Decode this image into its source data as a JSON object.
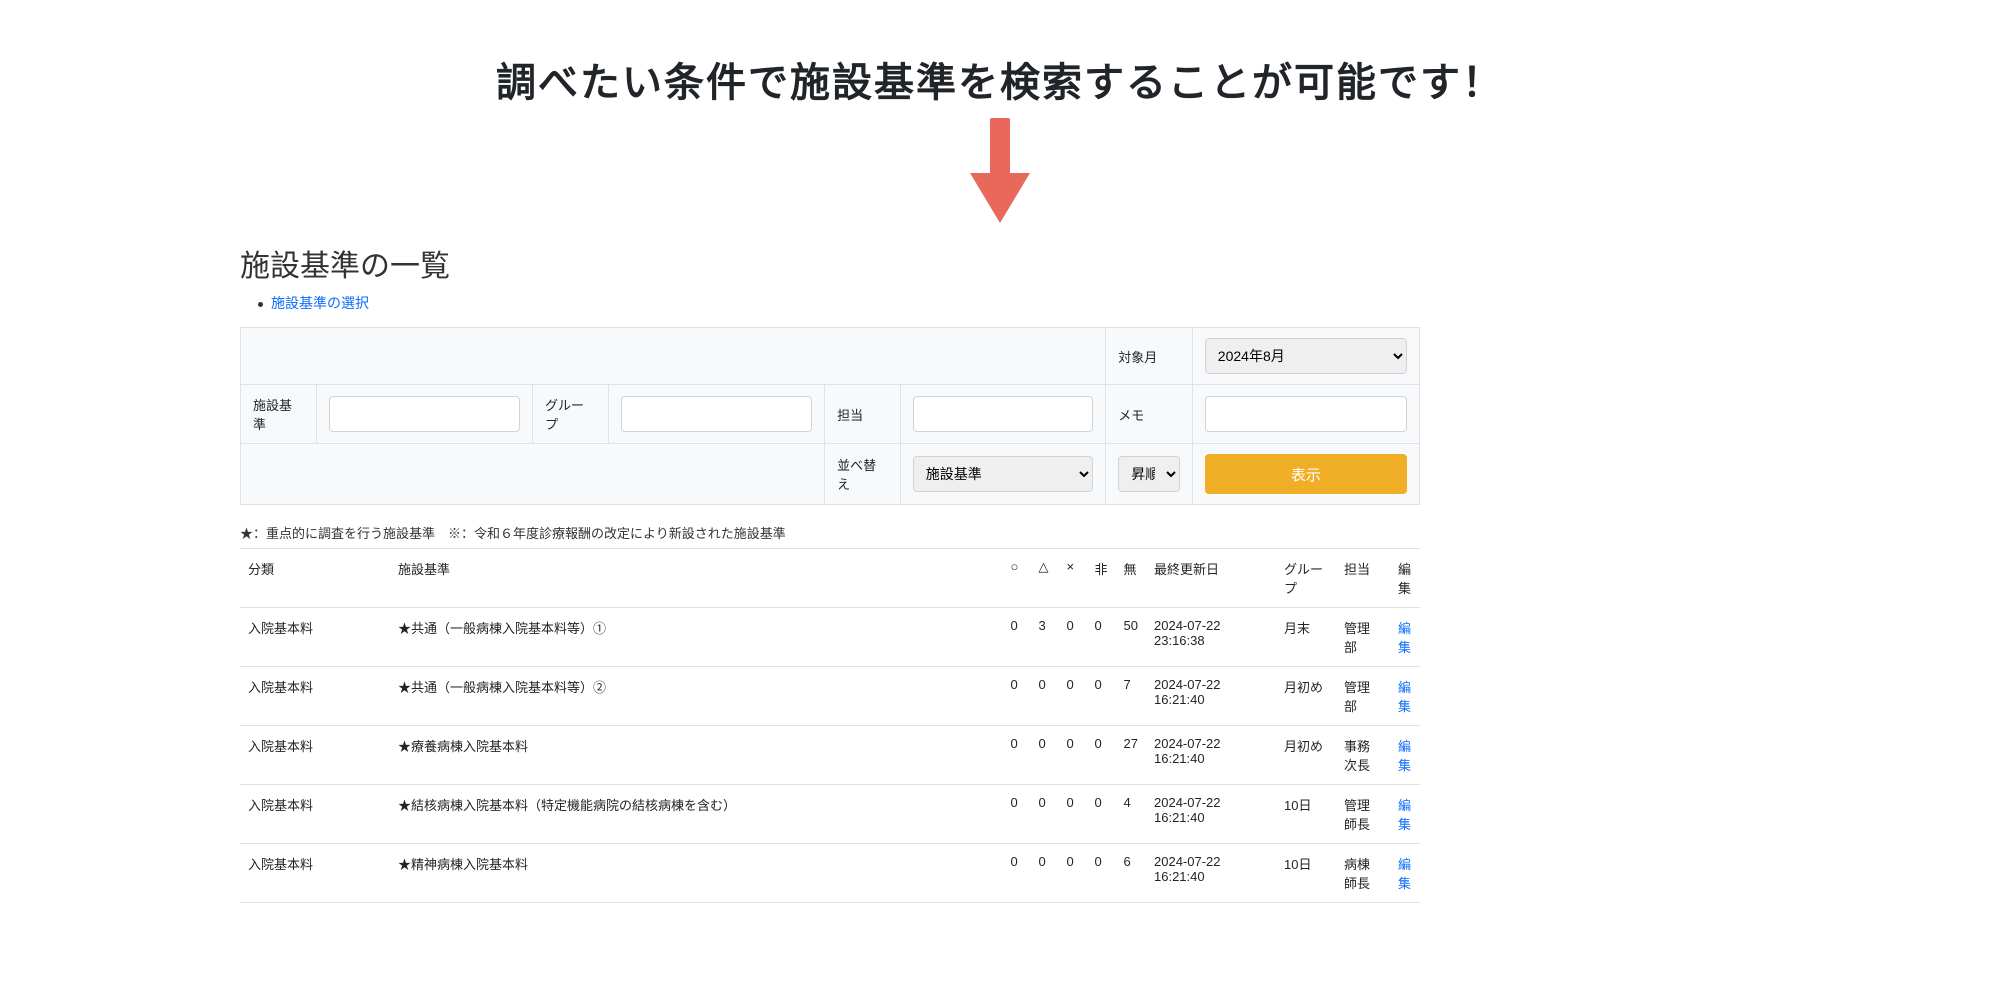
{
  "banner": "調べたい条件で施設基準を検索することが可能です！",
  "title": "施設基準の一覧",
  "breadcrumb_link": "施設基準の選択",
  "filter": {
    "target_month_label": "対象月",
    "target_month_value": "2024年8月",
    "kijun_label": "施設基準",
    "group_label": "グループ",
    "tantou_label": "担当",
    "memo_label": "メモ",
    "sort_label": "並べ替え",
    "sort_field_value": "施設基準",
    "sort_order_value": "昇順",
    "show_button": "表示"
  },
  "legend": "★：重点的に調査を行う施設基準　※：令和６年度診療報酬の改定により新設された施設基準",
  "columns": {
    "bunrui": "分類",
    "kijun": "施設基準",
    "circle": "○",
    "triangle": "△",
    "x": "×",
    "hi": "非",
    "mu": "無",
    "updated": "最終更新日",
    "group": "グループ",
    "tantou": "担当",
    "edit": "編集"
  },
  "rows": [
    {
      "bunrui": "入院基本料",
      "kijun": "★共通（一般病棟入院基本料等）①",
      "o": "0",
      "t": "3",
      "x": "0",
      "hi": "0",
      "mu": "50",
      "updated": "2024-07-22 23:16:38",
      "group": "月末",
      "tantou": "管理部",
      "edit": "編集"
    },
    {
      "bunrui": "入院基本料",
      "kijun": "★共通（一般病棟入院基本料等）②",
      "o": "0",
      "t": "0",
      "x": "0",
      "hi": "0",
      "mu": "7",
      "updated": "2024-07-22 16:21:40",
      "group": "月初め",
      "tantou": "管理部",
      "edit": "編集"
    },
    {
      "bunrui": "入院基本料",
      "kijun": "★療養病棟入院基本料",
      "o": "0",
      "t": "0",
      "x": "0",
      "hi": "0",
      "mu": "27",
      "updated": "2024-07-22 16:21:40",
      "group": "月初め",
      "tantou": "事務次長",
      "edit": "編集"
    },
    {
      "bunrui": "入院基本料",
      "kijun": "★結核病棟入院基本料（特定機能病院の結核病棟を含む）",
      "o": "0",
      "t": "0",
      "x": "0",
      "hi": "0",
      "mu": "4",
      "updated": "2024-07-22 16:21:40",
      "group": "10日",
      "tantou": "管理師長",
      "edit": "編集"
    },
    {
      "bunrui": "入院基本料",
      "kijun": "★精神病棟入院基本料",
      "o": "0",
      "t": "0",
      "x": "0",
      "hi": "0",
      "mu": "6",
      "updated": "2024-07-22 16:21:40",
      "group": "10日",
      "tantou": "病棟師長",
      "edit": "編集"
    }
  ]
}
